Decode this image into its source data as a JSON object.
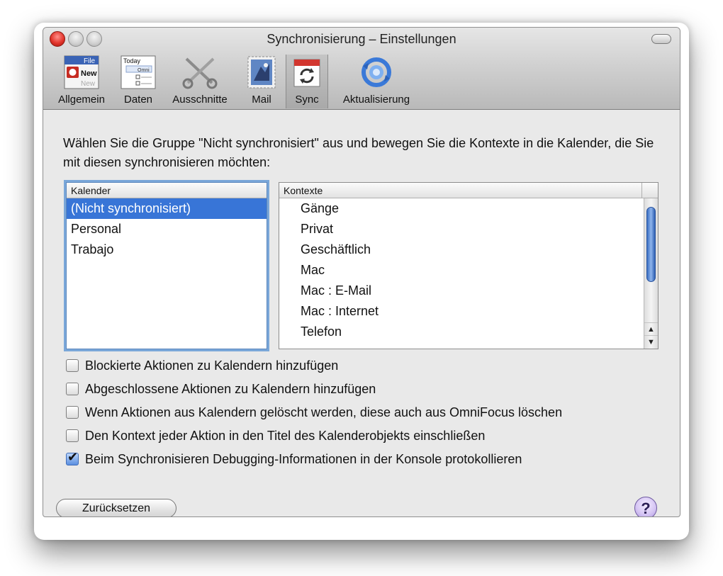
{
  "window": {
    "title": "Synchronisierung – Einstellungen"
  },
  "toolbar": {
    "items": [
      {
        "label": "Allgemein",
        "icon": "preferences-general-icon"
      },
      {
        "label": "Daten",
        "icon": "data-outline-icon"
      },
      {
        "label": "Ausschnitte",
        "icon": "scissors-icon"
      },
      {
        "label": "Mail",
        "icon": "mail-stamp-icon"
      },
      {
        "label": "Sync",
        "icon": "calendar-sync-icon",
        "selected": true
      },
      {
        "label": "Aktualisierung",
        "icon": "software-update-icon"
      }
    ],
    "icon_text": {
      "file": "File",
      "new": "New",
      "today": "Today",
      "omni": "Omni"
    }
  },
  "instructions": "Wählen Sie die Gruppe \"Nicht synchronisiert\" aus und bewegen Sie die Kontexte in die Kalender, die Sie mit diesen synchronisieren möchten:",
  "kalender": {
    "header": "Kalender",
    "items": [
      "(Nicht synchronisiert)",
      "Personal",
      "Trabajo"
    ],
    "selected_index": 0
  },
  "kontexte": {
    "header": "Kontexte",
    "items": [
      "Gänge",
      "Privat",
      "Geschäftlich",
      "Mac",
      "Mac : E-Mail",
      "Mac : Internet",
      "Telefon"
    ]
  },
  "options": [
    {
      "label": "Blockierte Aktionen zu Kalendern hinzufügen",
      "checked": false
    },
    {
      "label": "Abgeschlossene Aktionen zu Kalendern hinzufügen",
      "checked": false
    },
    {
      "label": "Wenn Aktionen aus Kalendern gelöscht werden, diese auch aus OmniFocus löschen",
      "checked": false
    },
    {
      "label": "Den Kontext jeder Aktion in den Titel des Kalenderobjekts einschließen",
      "checked": false
    },
    {
      "label": "Beim Synchronisieren Debugging-Informationen in der Konsole protokollieren",
      "checked": true
    }
  ],
  "buttons": {
    "reset": "Zurücksetzen",
    "help": "?"
  },
  "colors": {
    "selection": "#3875d7",
    "focus_ring": "#7aa7d9",
    "close": "#e2352c"
  }
}
